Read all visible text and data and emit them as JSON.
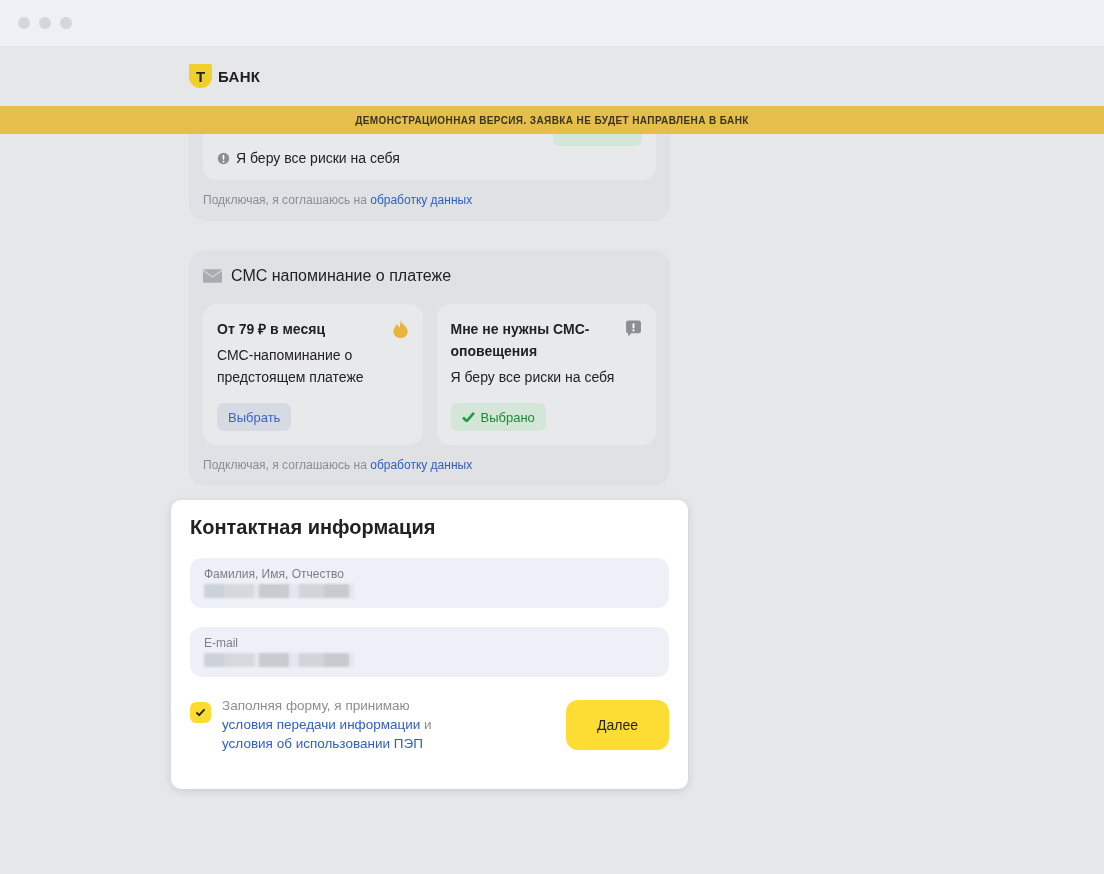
{
  "logo": {
    "mark": "Т",
    "text": "БАНК"
  },
  "banner": "ДЕМОНСТРАЦИОННАЯ ВЕРСИЯ. ЗАЯВКА НЕ БУДЕТ НАПРАВЛЕНА В БАНК",
  "top_section": {
    "option": {
      "description": "Я беру все риски на себя",
      "selected": true
    },
    "consent": {
      "text": "Подключая, я соглашаюсь на",
      "link": "обработку данных"
    }
  },
  "sms_section": {
    "title": "СМС напоминание о платеже",
    "options": [
      {
        "kind": "paid",
        "title": "От 79 ₽ в месяц",
        "description": "СМС-напоминание о предстоящем платеже",
        "button": "Выбрать",
        "selected": false
      },
      {
        "kind": "decline",
        "title": "Мне не нужны СМС-оповещения",
        "description": "Я беру все риски на себя",
        "button": "Выбрано",
        "selected": true
      }
    ],
    "consent": {
      "text": "Подключая, я соглашаюсь на",
      "link": "обработку данных"
    }
  },
  "contact": {
    "title": "Контактная информация",
    "fields": [
      {
        "label": "Фамилия, Имя, Отчество"
      },
      {
        "label": "E-mail"
      }
    ],
    "agreement": {
      "checked": true,
      "text": "Заполняя форму, я принимаю",
      "link_1": "условия передачи информации",
      "joiner": "и",
      "link_2": "условия об использовании ПЭП"
    },
    "button": "Далее"
  }
}
